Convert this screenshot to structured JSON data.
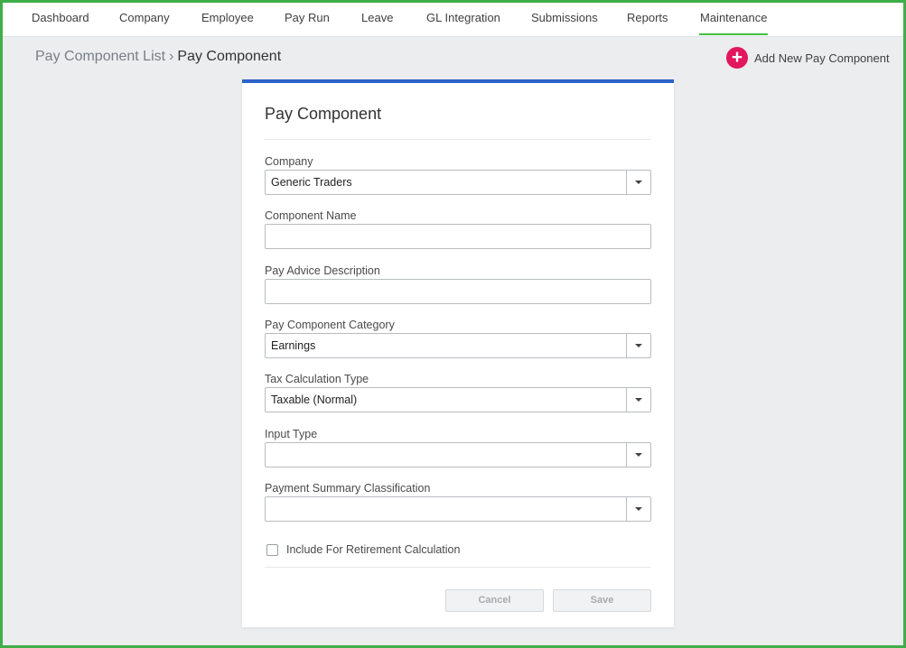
{
  "nav": {
    "items": [
      {
        "label": "Dashboard"
      },
      {
        "label": "Company"
      },
      {
        "label": "Employee"
      },
      {
        "label": "Pay Run"
      },
      {
        "label": "Leave"
      },
      {
        "label": "GL Integration"
      },
      {
        "label": "Submissions"
      },
      {
        "label": "Reports"
      },
      {
        "label": "Maintenance",
        "active": true
      }
    ]
  },
  "breadcrumb": {
    "parent": "Pay Component List",
    "separator": "›",
    "current": "Pay Component"
  },
  "actions": {
    "add_icon": "plus-icon",
    "add_label": "Add New Pay Component"
  },
  "form": {
    "title": "Pay Component",
    "company": {
      "label": "Company",
      "value": "Generic Traders"
    },
    "component_name": {
      "label": "Component Name",
      "value": ""
    },
    "pay_advice_description": {
      "label": "Pay Advice Description",
      "value": ""
    },
    "pay_component_category": {
      "label": "Pay Component Category",
      "value": "Earnings"
    },
    "tax_calculation_type": {
      "label": "Tax Calculation Type",
      "value": "Taxable (Normal)"
    },
    "input_type": {
      "label": "Input Type",
      "value": ""
    },
    "payment_summary_classification": {
      "label": "Payment Summary Classification",
      "value": ""
    },
    "retirement": {
      "label": "Include For Retirement Calculation",
      "checked": false
    },
    "cancel_label": "Cancel",
    "save_label": "Save"
  },
  "colors": {
    "active_tab_underline": "#3fbf3f",
    "card_accent": "#2e63c9",
    "add_button": "#e3175b",
    "window_border": "#3fae49"
  }
}
